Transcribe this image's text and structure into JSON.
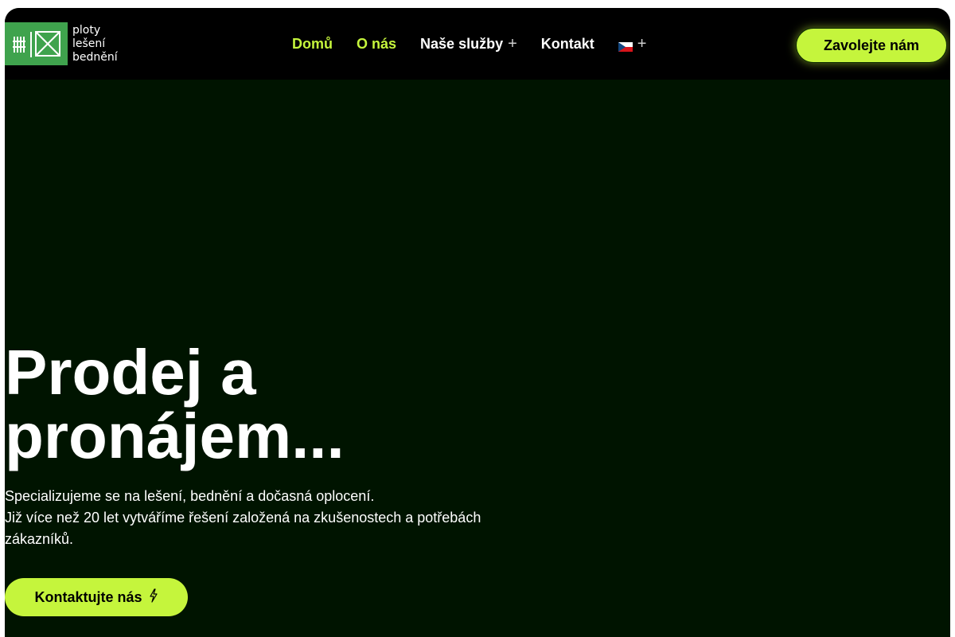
{
  "brand": {
    "lines": [
      "ploty",
      "lešení",
      "bednění"
    ],
    "color": "#3fa34d"
  },
  "nav": {
    "items": [
      {
        "label": "Domů",
        "active": true
      },
      {
        "label": "O nás",
        "active": true
      },
      {
        "label": "Naše služby",
        "has_submenu": true
      },
      {
        "label": "Kontakt"
      }
    ],
    "submenu_icon": "plus-icon",
    "language": {
      "icon": "czech-flag-icon",
      "submenu_icon": "plus-icon"
    },
    "cta_label": "Zavolejte nám"
  },
  "hero": {
    "title_line1": "Prodej a",
    "title_line2": "pronájem...",
    "desc_line1": "Specializujeme se na lešení, bednění a dočasná oplocení.",
    "desc_line2": "Již více než 20 let vytváříme řešení založená na zkušenostech a potřebách zákazníků.",
    "cta_label": "Kontaktujte nás",
    "cta_icon": "lightning-icon"
  },
  "colors": {
    "accent": "#c5f53c",
    "nav_bg": "#000000",
    "hero_bg": "#001400"
  }
}
